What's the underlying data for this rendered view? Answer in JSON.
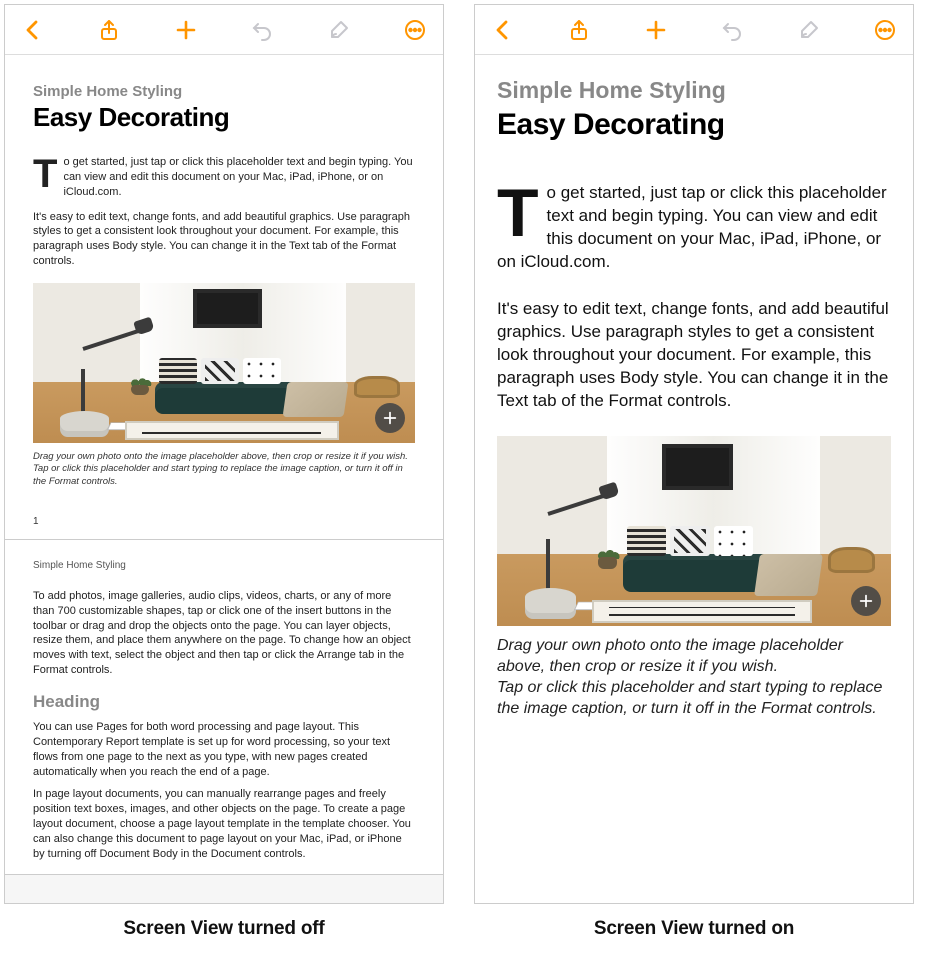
{
  "toolbar": {
    "back": "Back",
    "share": "Share",
    "add": "Add",
    "undo": "Undo",
    "brush": "Format",
    "more": "More"
  },
  "doc": {
    "subtitle": "Simple Home Styling",
    "title": "Easy Decorating",
    "intro": "To get started, just tap or click this placeholder text and begin typing. You can view and edit this document on your Mac, iPad, iPhone, or on iCloud.com.",
    "body1": "It's easy to edit text, change fonts, and add beautiful graphics. Use paragraph styles to get a consistent look throughout your document. For example, this paragraph uses Body style. You can change it in the Text tab of the Format controls.",
    "caption1": "Drag your own photo onto the image placeholder above, then crop or resize it if you wish.",
    "caption2": "Tap or click this placeholder and start typing to replace the image caption, or turn it off in the Format controls.",
    "page_number": "1",
    "page2": {
      "header": "Simple Home Styling",
      "body1": "To add photos, image galleries, audio clips, videos, charts, or any of more than 700 customizable shapes, tap or click one of the insert buttons in the toolbar or drag and drop the objects onto the page. You can layer objects, resize them, and place them anywhere on the page. To change how an object moves with text, select the object and then tap or click the Arrange tab in the Format controls.",
      "heading": "Heading",
      "body2": "You can use Pages for both word processing and page layout. This Contemporary Report template is set up for word processing, so your text flows from one page to the next as you type, with new pages created automatically when you reach the end of a page.",
      "body3": "In page layout documents, you can manually rearrange pages and freely position text boxes, images, and other objects on the page. To create a page layout document, choose a page layout template in the template chooser. You can also change this document to page layout on your Mac, iPad, or iPhone by turning off Document Body in the Document controls."
    }
  },
  "labels": {
    "left": "Screen View turned off",
    "right": "Screen View turned on"
  }
}
